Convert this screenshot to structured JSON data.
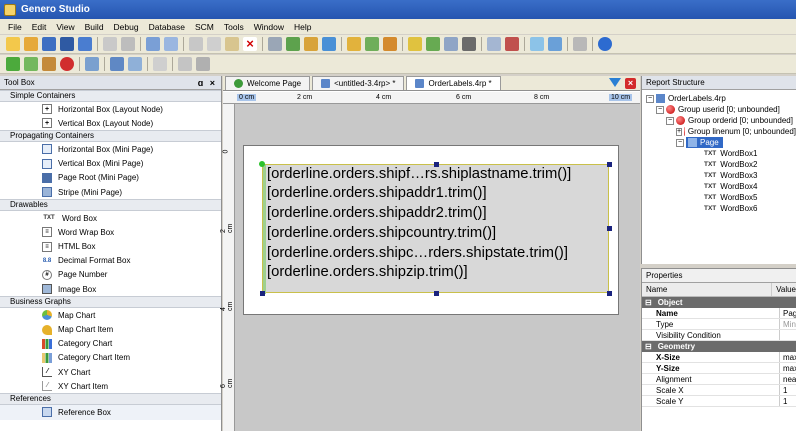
{
  "app": {
    "title": "Genero Studio"
  },
  "menu": [
    "File",
    "Edit",
    "View",
    "Build",
    "Debug",
    "Database",
    "SCM",
    "Tools",
    "Window",
    "Help"
  ],
  "toolbox": {
    "title": "Tool Box",
    "controls": "×",
    "sections": [
      {
        "label": "Simple Containers",
        "items": [
          {
            "label": "Horizontal Box (Layout Node)",
            "icon": "hbox-icon"
          },
          {
            "label": "Vertical Box (Layout Node)",
            "icon": "vbox-icon"
          }
        ]
      },
      {
        "label": "Propagating Containers",
        "items": [
          {
            "label": "Horizontal Box (Mini Page)",
            "icon": "hbox-mini-icon"
          },
          {
            "label": "Vertical Box (Mini Page)",
            "icon": "vbox-mini-icon"
          },
          {
            "label": "Page Root (Mini Page)",
            "icon": "page-root-icon"
          },
          {
            "label": "Stripe (Mini Page)",
            "icon": "stripe-icon"
          }
        ]
      },
      {
        "label": "Drawables",
        "items": [
          {
            "label": "Word Box",
            "icon": "word-box-icon"
          },
          {
            "label": "Word Wrap Box",
            "icon": "word-wrap-icon"
          },
          {
            "label": "HTML Box",
            "icon": "html-box-icon"
          },
          {
            "label": "Decimal Format Box",
            "icon": "decimal-format-icon"
          },
          {
            "label": "Page Number",
            "icon": "page-number-icon"
          },
          {
            "label": "Image Box",
            "icon": "image-box-icon"
          }
        ]
      },
      {
        "label": "Business Graphs",
        "items": [
          {
            "label": "Map Chart",
            "icon": "map-chart-icon"
          },
          {
            "label": "Map Chart Item",
            "icon": "map-chart-item-icon"
          },
          {
            "label": "Category Chart",
            "icon": "category-chart-icon"
          },
          {
            "label": "Category Chart Item",
            "icon": "category-chart-item-icon"
          },
          {
            "label": "XY Chart",
            "icon": "xy-chart-icon"
          },
          {
            "label": "XY Chart Item",
            "icon": "xy-chart-item-icon"
          }
        ]
      },
      {
        "label": "References",
        "items": [
          {
            "label": "Reference Box",
            "icon": "reference-box-icon"
          }
        ]
      }
    ]
  },
  "editor": {
    "tabs": [
      {
        "label": "Welcome Page",
        "icon": "welcome-icon"
      },
      {
        "label": "<untitled-3.4rp> *",
        "icon": "report-icon"
      },
      {
        "label": "OrderLabels.4rp *",
        "icon": "report-icon",
        "active": true
      }
    ],
    "ruler_h": [
      "0 cm",
      "2 cm",
      "4 cm",
      "6 cm",
      "8 cm",
      "10 cm"
    ],
    "ruler_v": [
      "0",
      "2 cm",
      "4 cm",
      "6 cm"
    ],
    "word_boxes": [
      "[orderline.orders.shipf…rs.shiplastname.trim()]",
      "[orderline.orders.shipaddr1.trim()]",
      "[orderline.orders.shipaddr2.trim()]",
      "[orderline.orders.shipcountry.trim()]",
      "[orderline.orders.shipc…rders.shipstate.trim()]",
      "[orderline.orders.shipzip.trim()]"
    ]
  },
  "structure": {
    "title": "Report Structure",
    "nodes": [
      {
        "label": "OrderLabels.4rp",
        "level": 0,
        "kind": "report"
      },
      {
        "label": "Group userid [0; unbounded]",
        "level": 1,
        "kind": "group"
      },
      {
        "label": "Group orderid [0; unbounded]",
        "level": 2,
        "kind": "group"
      },
      {
        "label": "Group linenum [0; unbounded]",
        "level": 3,
        "kind": "group"
      },
      {
        "label": "Page",
        "level": 3,
        "kind": "page",
        "selected": true
      },
      {
        "label": "WordBox1",
        "level": 4,
        "kind": "txt"
      },
      {
        "label": "WordBox2",
        "level": 4,
        "kind": "txt"
      },
      {
        "label": "WordBox3",
        "level": 4,
        "kind": "txt"
      },
      {
        "label": "WordBox4",
        "level": 4,
        "kind": "txt"
      },
      {
        "label": "WordBox5",
        "level": 4,
        "kind": "txt"
      },
      {
        "label": "WordBox6",
        "level": 4,
        "kind": "txt"
      }
    ]
  },
  "properties": {
    "title": "Properties",
    "col_name": "Name",
    "col_value": "Value",
    "groups": [
      {
        "label": "Object",
        "rows": [
          {
            "name": "Name",
            "value": "Page",
            "bold": true
          },
          {
            "name": "Type",
            "value": "MiniPage"
          },
          {
            "name": "Visibility Condition",
            "value": ""
          }
        ]
      },
      {
        "label": "Geometry",
        "rows": [
          {
            "name": "X-Size",
            "value": "max",
            "bold": true
          },
          {
            "name": "Y-Size",
            "value": "max",
            "bold": true
          },
          {
            "name": "Alignment",
            "value": "near"
          },
          {
            "name": "Scale X",
            "value": "1"
          },
          {
            "name": "Scale Y",
            "value": "1"
          }
        ]
      }
    ]
  }
}
